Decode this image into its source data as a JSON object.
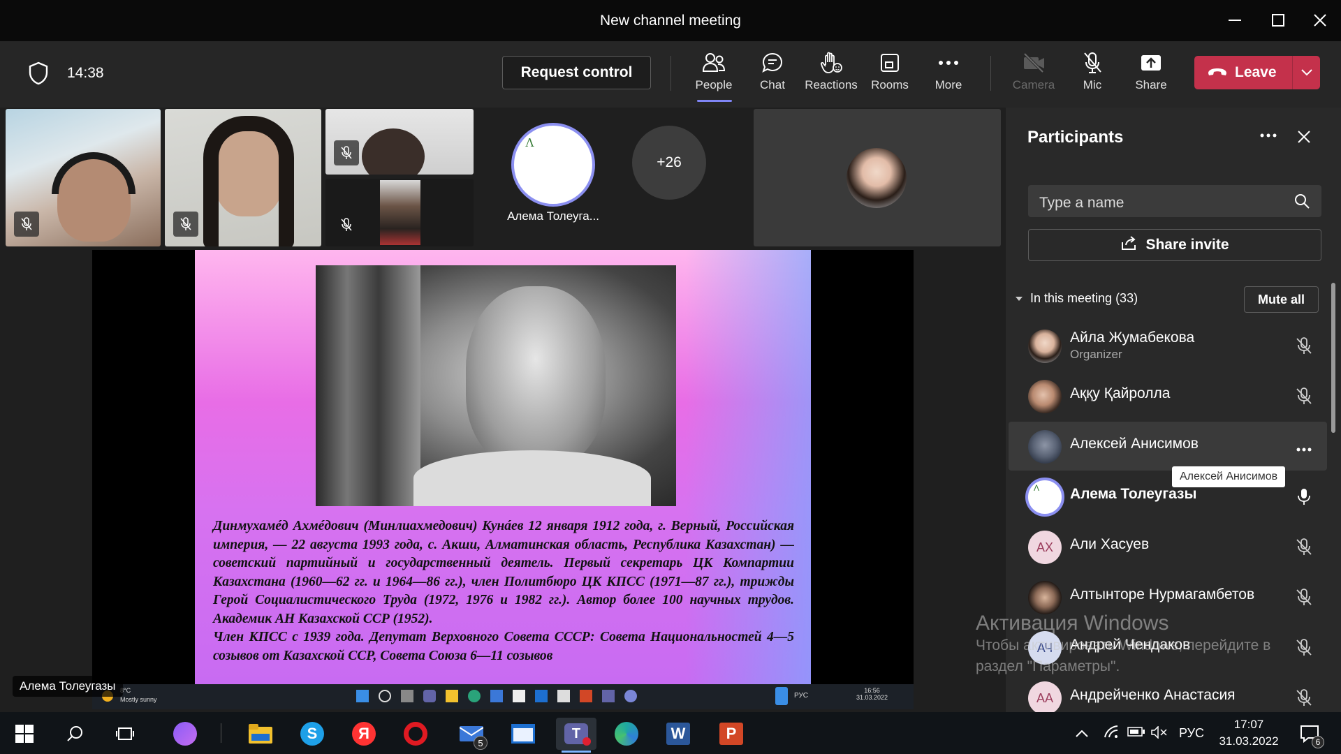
{
  "window": {
    "title": "New channel meeting"
  },
  "toolbar": {
    "time": "14:38",
    "request_control": "Request control",
    "people": "People",
    "chat": "Chat",
    "reactions": "Reactions",
    "rooms": "Rooms",
    "more": "More",
    "camera": "Camera",
    "mic": "Mic",
    "share": "Share",
    "leave": "Leave"
  },
  "gallery": {
    "alema_name": "Алема Толеуга...",
    "overflow_count": "+26"
  },
  "slide": {
    "paragraph1": "Динмухамéд Ахмéдович (Минлиахмедович) Кунáев 12 января 1912 года, г. Верный, Российская империя, — 22 августа 1993 года, с. Акши, Алматинская область, Республика Казахстан) — советский партийный и государственный деятель. Первый секретарь ЦК Компартии Казахстана (1960—62 гг. и 1964—86 гг.), член Политбюро ЦК КПСС (1971—87 гг.), трижды Герой Социалистического Труда (1972, 1976 и 1982 гг.). Автор более 100 научных трудов. Академик АН Казахской ССР (1952).",
    "paragraph2": "Член КПСС с 1939 года. Депутат Верховного Совета СССР: Совета Национальностей 4—5 созывов от Казахской ССР, Совета Союза 6—11 созывов"
  },
  "shared_taskbar": {
    "weather_temp": "8°C",
    "weather_text": "Mostly sunny",
    "lang": "РУС",
    "time": "16:56",
    "date": "31.03.2022"
  },
  "presenter_label": "Алема Толеугазы",
  "panel": {
    "title": "Participants",
    "search_placeholder": "Type a name",
    "share_invite": "Share invite",
    "in_meeting": "In this meeting (33)",
    "mute_all": "Mute all",
    "tooltip": "Алексей Анисимов",
    "participants": [
      {
        "name": "Айла Жумабекова",
        "role": "Organizer",
        "initials": ""
      },
      {
        "name": "Аққу Қайролла",
        "role": "",
        "initials": ""
      },
      {
        "name": "Алексей Анисимов",
        "role": "",
        "initials": ""
      },
      {
        "name": "Алема Толеугазы",
        "role": "",
        "initials": ""
      },
      {
        "name": "Али Хасуев",
        "role": "",
        "initials": "АХ"
      },
      {
        "name": "Алтынторе Нурмагамбетов",
        "role": "",
        "initials": ""
      },
      {
        "name": "Андрей Чендаков",
        "role": "",
        "initials": "АЧ"
      },
      {
        "name": "Андрейченко Анастасия",
        "role": "",
        "initials": "АА"
      }
    ]
  },
  "watermark": {
    "heading": "Активация Windows",
    "line1": "Чтобы активировать Windows, перейдите в",
    "line2": "раздел \"Параметры\"."
  },
  "taskbar": {
    "lang": "РУС",
    "time": "17:07",
    "date": "31.03.2022",
    "mail_badge": "5",
    "notif_badge": "6"
  }
}
